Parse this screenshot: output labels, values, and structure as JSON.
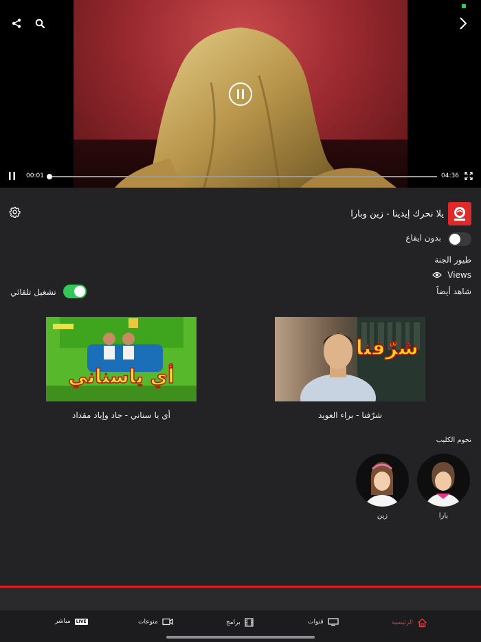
{
  "player": {
    "current_time": "00:01",
    "duration": "04:36",
    "progress_fraction": 0.004,
    "icons": [
      "share-icon",
      "search-icon",
      "chevron-right-icon",
      "pause-icon",
      "fullscreen-icon"
    ]
  },
  "info": {
    "video_title": "يلا نحرك إيدينا - زين وبارا",
    "no_music_label": "بدون ايقاع",
    "no_music_enabled": false,
    "channel_name": "طيور الجنة",
    "views_label": "Views",
    "see_also": "شاهد أيضاً",
    "autoplay_label": "تشغيل تلقائي",
    "autoplay_enabled": true,
    "accent_on": "#34c759"
  },
  "related": [
    {
      "title": "شرّفنا - براء العويد",
      "overlay": "شرّفنا"
    },
    {
      "title": "أي يا سناني - جاد وإياد مقداد",
      "overlay": "أي ياسناني"
    }
  ],
  "stars": {
    "heading": "نجوم الكليب",
    "items": [
      {
        "name": "بارا"
      },
      {
        "name": "زين"
      }
    ]
  },
  "tabbar": {
    "home": "الرئيسية",
    "channels": "قنوات",
    "programs": "برامج",
    "variety": "منوعات",
    "live": "مباشر",
    "live_badge": "LIVE",
    "active_color": "#e8363a"
  },
  "brand_red": "#e0201f"
}
